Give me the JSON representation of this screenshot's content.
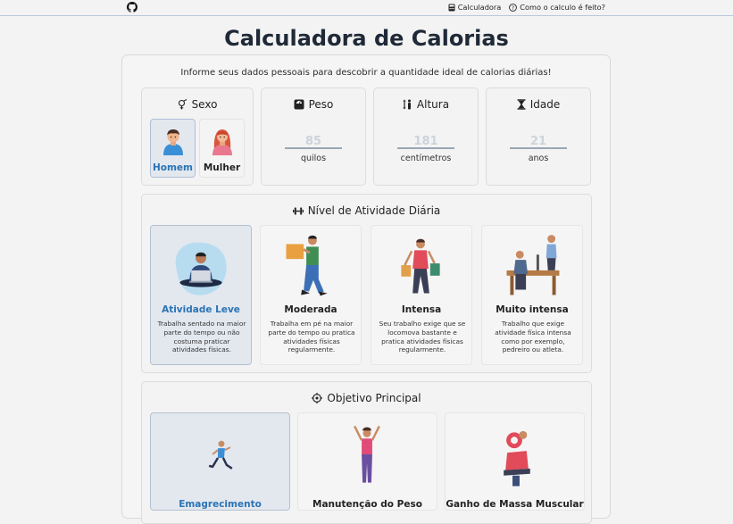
{
  "header": {
    "github_icon": "github-icon",
    "nav": [
      {
        "icon": "calculator-icon",
        "label": "Calculadora"
      },
      {
        "icon": "question-circle-icon",
        "label": "Como o calculo é feito?"
      }
    ]
  },
  "page_title": "Calculadora de Calorias",
  "intro": "Informe seus dados pessoais para descobrir a quantidade ideal de calorias diárias!",
  "sex": {
    "title": "Sexo",
    "icon": "gender-icon",
    "options": [
      {
        "label": "Homem",
        "selected": true
      },
      {
        "label": "Mulher",
        "selected": false
      }
    ]
  },
  "weight": {
    "title": "Peso",
    "icon": "scale-icon",
    "placeholder": "85",
    "unit": "quilos"
  },
  "height": {
    "title": "Altura",
    "icon": "height-icon",
    "placeholder": "181",
    "unit": "centímetros"
  },
  "age": {
    "title": "Idade",
    "icon": "hourglass-icon",
    "placeholder": "21",
    "unit": "anos"
  },
  "activity": {
    "title": "Nível de Atividade Diária",
    "icon": "dumbbell-icon",
    "options": [
      {
        "name": "Atividade Leve",
        "desc": "Trabalha sentado na maior parte do tempo ou não costuma praticar atividades físicas.",
        "selected": true
      },
      {
        "name": "Moderada",
        "desc": "Trabalha em pé na maior parte do tempo ou pratica atividades físicas regularmente.",
        "selected": false
      },
      {
        "name": "Intensa",
        "desc": "Seu trabalho exige que se locomova bastante e pratica atividades físicas regularmente.",
        "selected": false
      },
      {
        "name": "Muito intensa",
        "desc": "Trabalho que exige atividade física intensa como por exemplo, pedreiro ou atleta.",
        "selected": false
      }
    ]
  },
  "goal": {
    "title": "Objetivo Principal",
    "icon": "crosshair-icon",
    "options": [
      {
        "name": "Emagrecimento",
        "selected": true
      },
      {
        "name": "Manutenção do Peso",
        "selected": false
      },
      {
        "name": "Ganho de Massa Muscular",
        "selected": false
      }
    ]
  },
  "colors": {
    "accent": "#2a73b5",
    "selected_bg": "#e3e8ef",
    "title": "#1f2937"
  }
}
